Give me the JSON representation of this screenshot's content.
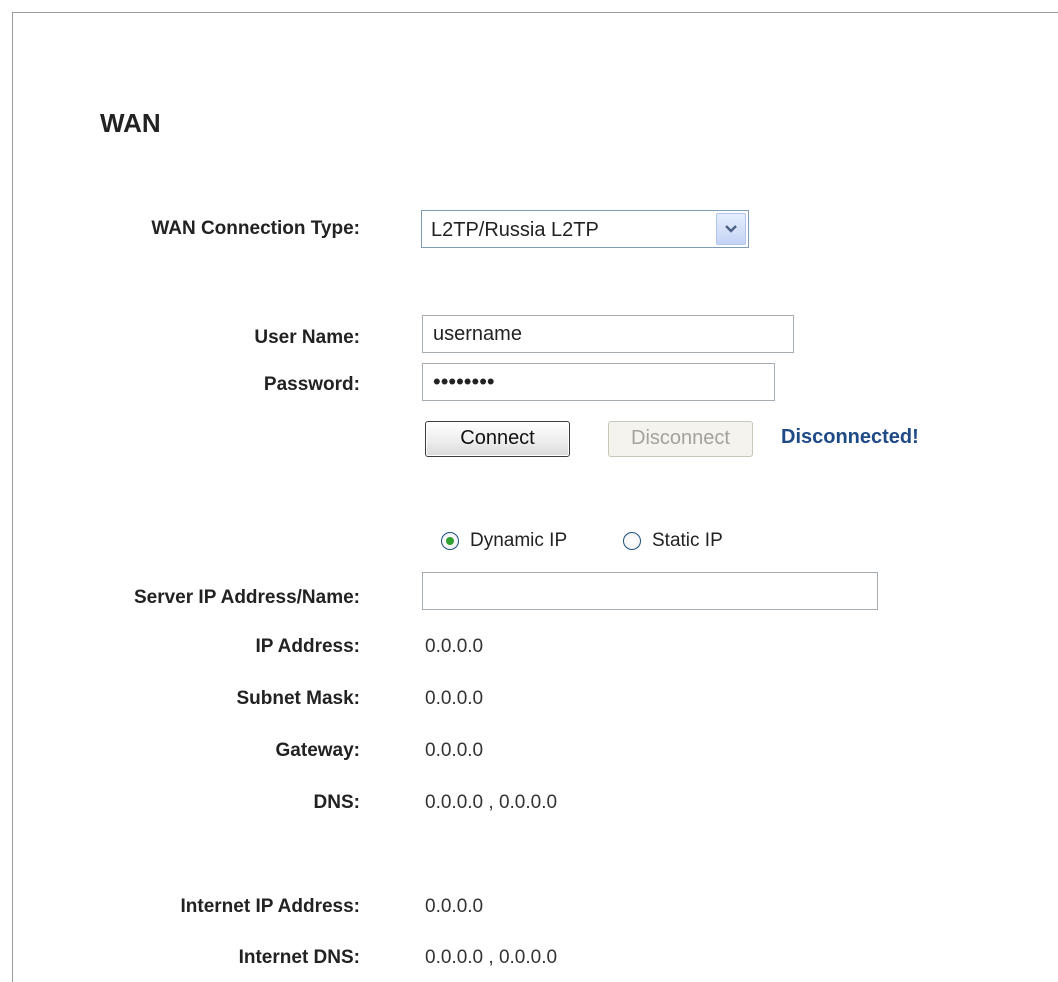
{
  "section_title": "WAN",
  "connection_type": {
    "label": "WAN Connection Type:",
    "selected": "L2TP/Russia L2TP"
  },
  "credentials": {
    "username_label": "User Name:",
    "username_value": "username",
    "password_label": "Password:",
    "password_value": "password"
  },
  "actions": {
    "connect_label": "Connect",
    "disconnect_label": "Disconnect",
    "status": "Disconnected!",
    "status_color": "#1e4a86"
  },
  "ip_mode": {
    "dynamic_label": "Dynamic IP",
    "static_label": "Static IP",
    "selected": "Dynamic IP"
  },
  "server": {
    "label": "Server IP Address/Name:",
    "value": ""
  },
  "fields": {
    "ip_address_label": "IP Address:",
    "ip_address_value": "0.0.0.0",
    "subnet_label": "Subnet Mask:",
    "subnet_value": "0.0.0.0",
    "gateway_label": "Gateway:",
    "gateway_value": "0.0.0.0",
    "dns_label": "DNS:",
    "dns_value": "0.0.0.0 , 0.0.0.0",
    "internet_ip_label": "Internet IP Address:",
    "internet_ip_value": "0.0.0.0",
    "internet_dns_label": "Internet DNS:",
    "internet_dns_value": "0.0.0.0 , 0.0.0.0"
  },
  "icons": {
    "dropdown": "chevron-down-icon",
    "radio_selected": "radio-checked-icon",
    "radio_unselected": "radio-unchecked-icon"
  }
}
